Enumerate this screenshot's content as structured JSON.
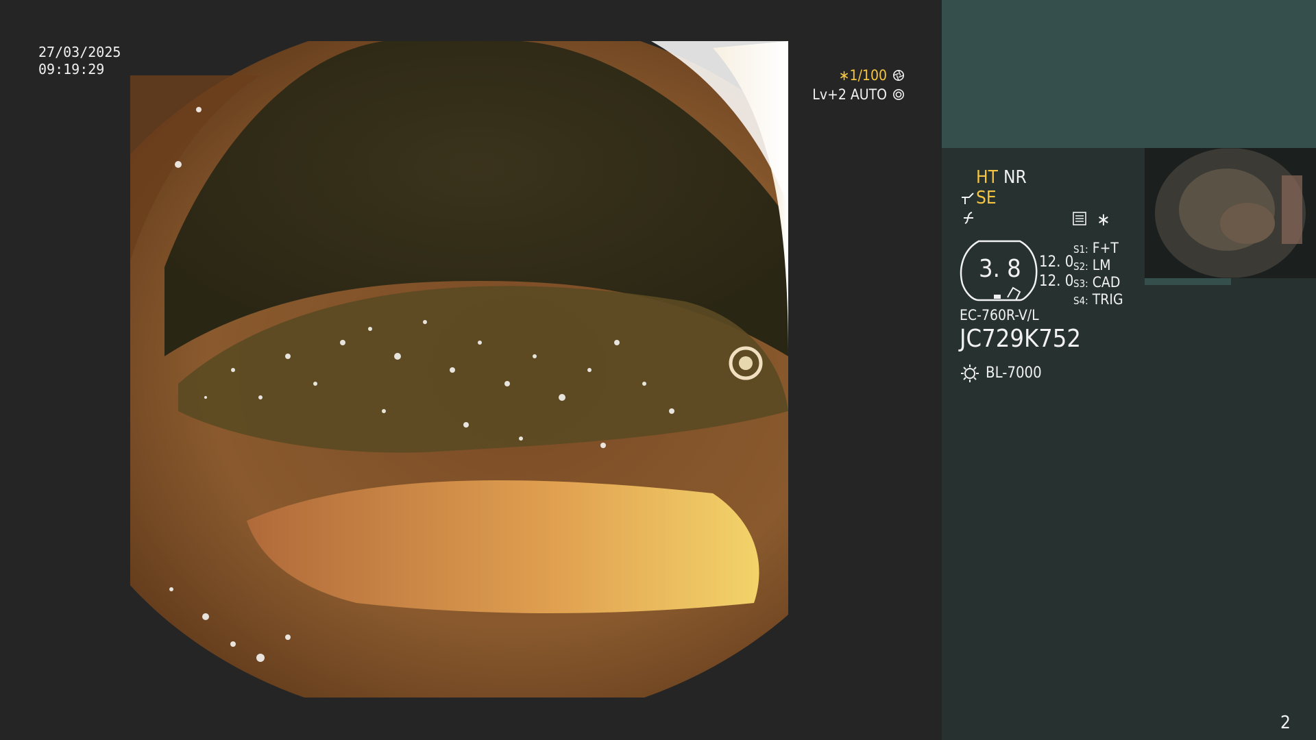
{
  "overlay": {
    "date": "27/03/2025",
    "time": "09:19:29",
    "shutter": "∗1/100",
    "light_mode": "Lv+2 AUTO"
  },
  "panel": {
    "modes": {
      "ht": "HT",
      "nr": "NR",
      "se": "SE"
    },
    "asterisk": "∗",
    "zoom_value": "3. 8",
    "settings": [
      "12. 0",
      "12. 0"
    ],
    "switches": [
      {
        "key": "S1",
        "value": "F+T"
      },
      {
        "key": "S2",
        "value": "LM"
      },
      {
        "key": "S3",
        "value": "CAD"
      },
      {
        "key": "S4",
        "value": "TRIG"
      }
    ],
    "scope_model": "EC-760R-V/L",
    "scope_serial": "JC729K752",
    "light_source": "BL-7000",
    "page_number": "2"
  },
  "icons": [
    "aperture-icon",
    "ring-icon",
    "scope-tip-icon",
    "no-freeze-icon",
    "menu-list-icon",
    "light-source-icon"
  ],
  "colors": {
    "accent_yellow": "#f5c542",
    "panel_bg": "#263130",
    "panel_header": "#344f4c"
  }
}
